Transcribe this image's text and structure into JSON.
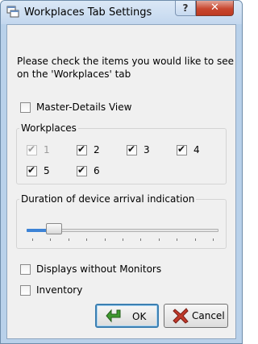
{
  "window": {
    "title": "Workplaces Tab Settings",
    "help_label": "?",
    "close_label": "✕"
  },
  "instructions": {
    "line1": "Please check the items you would like to see",
    "line2": "on the 'Workplaces' tab"
  },
  "master_details": {
    "label": "Master-Details View",
    "checked": false
  },
  "workplaces": {
    "title": "Workplaces",
    "items": [
      {
        "label": "1",
        "checked": true,
        "enabled": false
      },
      {
        "label": "2",
        "checked": true,
        "enabled": true
      },
      {
        "label": "3",
        "checked": true,
        "enabled": true
      },
      {
        "label": "4",
        "checked": true,
        "enabled": true
      },
      {
        "label": "5",
        "checked": true,
        "enabled": true
      },
      {
        "label": "6",
        "checked": true,
        "enabled": true
      }
    ]
  },
  "duration": {
    "title": "Duration of device arrival indication",
    "level": 0.12,
    "tick_count": 11
  },
  "displays_without_monitors": {
    "label": "Displays without Monitors",
    "checked": false
  },
  "inventory": {
    "label": "Inventory",
    "checked": false
  },
  "buttons": {
    "ok": {
      "label": "OK",
      "icon": "green-arrow-icon"
    },
    "cancel": {
      "label": "Cancel",
      "icon": "red-x-icon"
    }
  },
  "colors": {
    "title_bar": "#c3d7ee",
    "close_button": "#c8472f",
    "dialog_background": "#f0f0f0",
    "slider_fill": "#3d83d6",
    "default_button_border": "#3c7fb1"
  }
}
